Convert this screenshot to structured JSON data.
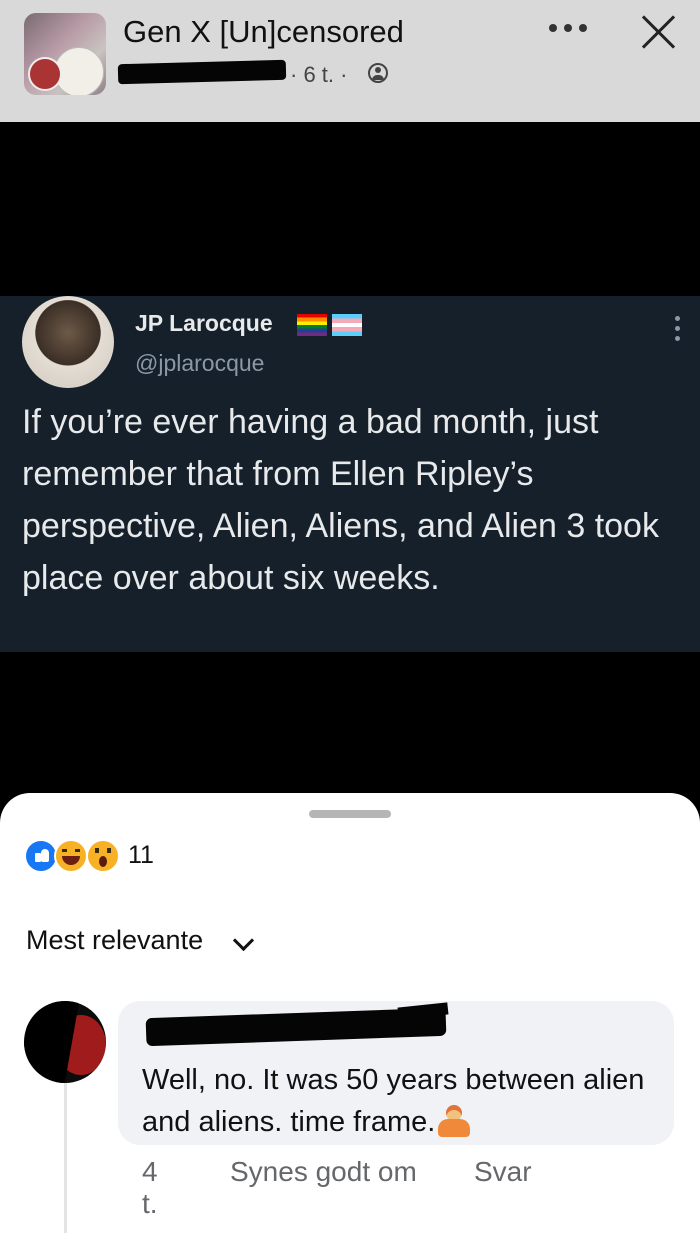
{
  "header": {
    "group_title": "Gen X [Un]censored",
    "post_meta": "· 6 t. ·"
  },
  "tweet": {
    "name": "JP Larocque",
    "handle": "@jplarocque",
    "text": "If you’re ever having a bad month, just remember that from Ellen Ripley’s perspective, Alien, Aliens, and Alien 3 took place over about six weeks."
  },
  "reactions": {
    "icons": [
      "like-icon",
      "haha-icon",
      "wow-icon"
    ],
    "count": "11"
  },
  "comments": {
    "sort_label": "Mest relevante",
    "items": [
      {
        "text": "Well, no. It was 50 years between alien and aliens.  time frame.",
        "time": "4 t.",
        "like_label": "Synes godt om",
        "reply_label": "Svar"
      }
    ]
  },
  "colors": {
    "header_bg": "#d9d9d9",
    "tweet_bg": "#15202b",
    "like_blue": "#1877f2",
    "bubble_bg": "#f0f2f5"
  }
}
